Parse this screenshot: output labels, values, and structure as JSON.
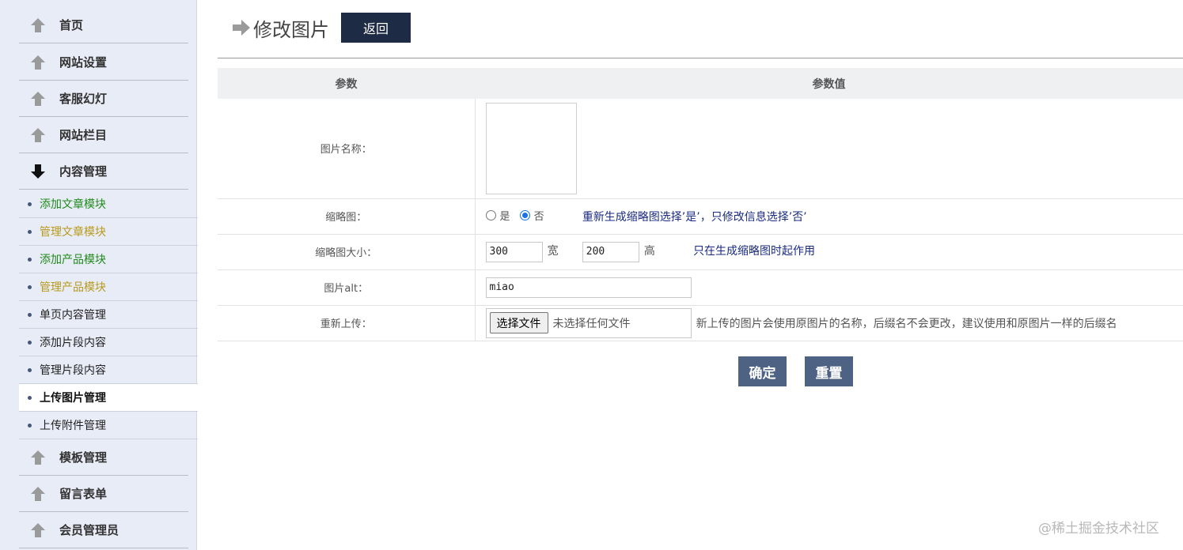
{
  "sidebar": {
    "menus_top": [
      {
        "label": "首页",
        "icon": "up-arrow-icon"
      },
      {
        "label": "网站设置",
        "icon": "up-arrow-icon"
      },
      {
        "label": "客服幻灯",
        "icon": "up-arrow-icon"
      },
      {
        "label": "网站栏目",
        "icon": "up-arrow-icon"
      },
      {
        "label": "内容管理",
        "icon": "down-arrow-icon"
      }
    ],
    "subitems": [
      {
        "label": "添加文章模块"
      },
      {
        "label": "管理文章模块"
      },
      {
        "label": "添加产品模块"
      },
      {
        "label": "管理产品模块"
      },
      {
        "label": "单页内容管理"
      },
      {
        "label": "添加片段内容"
      },
      {
        "label": "管理片段内容"
      },
      {
        "label": "上传图片管理"
      },
      {
        "label": "上传附件管理"
      }
    ],
    "menus_bottom": [
      {
        "label": "模板管理",
        "icon": "up-arrow-icon"
      },
      {
        "label": "留言表单",
        "icon": "up-arrow-icon"
      },
      {
        "label": "会员管理员",
        "icon": "up-arrow-icon"
      }
    ],
    "colors": {
      "green": "#208a1a",
      "gold": "#b89a1c",
      "active_bg": "#ffffff"
    }
  },
  "header": {
    "title": "修改图片",
    "back_label": "返回",
    "arrow_icon": "right-arrow-icon"
  },
  "table": {
    "col_param": "参数",
    "col_value": "参数值",
    "rows": {
      "image_name": {
        "label": "图片名称："
      },
      "thumbnail": {
        "label": "缩略图：",
        "option_yes": "是",
        "option_no": "否",
        "selected": "否",
        "note": "重新生成缩略图选择’是’，只修改信息选择’否’"
      },
      "thumb_size": {
        "label": "缩略图大小：",
        "width_value": "300",
        "width_unit": "宽",
        "height_value": "200",
        "height_unit": "高",
        "note": "只在生成缩略图时起作用"
      },
      "alt": {
        "label": "图片alt：",
        "value": "miao"
      },
      "reupload": {
        "label": "重新上传：",
        "button": "选择文件",
        "status": "未选择任何文件",
        "hint": "新上传的图片会使用原图片的名称，后缀名不会更改，建议使用和原图片一样的后缀名"
      }
    }
  },
  "actions": {
    "confirm": "确定",
    "reset": "重置"
  },
  "watermark": "@稀土掘金技术社区"
}
